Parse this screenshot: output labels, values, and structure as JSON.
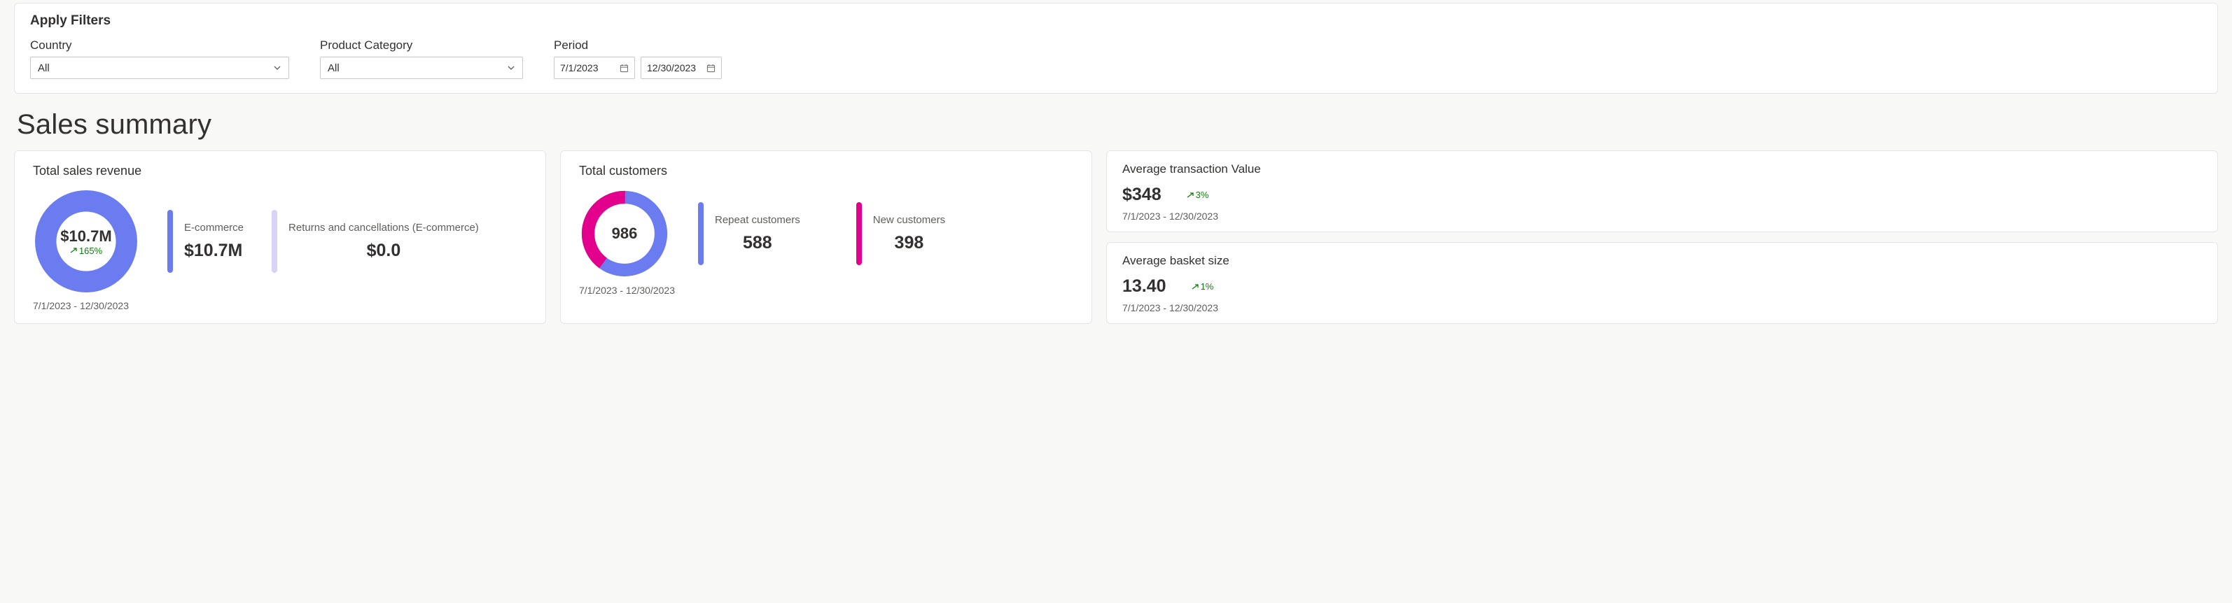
{
  "filters": {
    "title": "Apply Filters",
    "country": {
      "label": "Country",
      "value": "All"
    },
    "category": {
      "label": "Product Category",
      "value": "All"
    },
    "period": {
      "label": "Period",
      "start": "7/1/2023",
      "end": "12/30/2023"
    }
  },
  "section_title": "Sales summary",
  "revenue": {
    "title": "Total sales revenue",
    "daterange": "7/1/2023 - 12/30/2023",
    "total": "$10.7M",
    "delta": "165%",
    "ecommerce": {
      "label": "E-commerce",
      "value": "$10.7M"
    },
    "returns": {
      "label": "Returns and cancellations (E-commerce)",
      "value": "$0.0"
    }
  },
  "customers": {
    "title": "Total customers",
    "daterange": "7/1/2023 - 12/30/2023",
    "total": "986",
    "repeat": {
      "label": "Repeat customers",
      "value": "588"
    },
    "new": {
      "label": "New customers",
      "value": "398"
    }
  },
  "avg_txn": {
    "title": "Average transaction Value",
    "value": "$348",
    "delta": "3%",
    "daterange": "7/1/2023 - 12/30/2023"
  },
  "avg_basket": {
    "title": "Average basket size",
    "value": "13.40",
    "delta": "1%",
    "daterange": "7/1/2023 - 12/30/2023"
  },
  "colors": {
    "blue": "#6b7cf0",
    "lav": "#d8d3f5",
    "pink": "#e3008c",
    "green": "#107c10"
  },
  "chart_data": [
    {
      "type": "pie",
      "title": "Total sales revenue",
      "series": [
        {
          "name": "E-commerce",
          "value": 10.7,
          "unit": "$M",
          "color": "#6b7cf0"
        },
        {
          "name": "Returns and cancellations (E-commerce)",
          "value": 0.0,
          "unit": "$M",
          "color": "#d8d3f5"
        }
      ],
      "center_label": "$10.7M",
      "delta_pct": 165
    },
    {
      "type": "pie",
      "title": "Total customers",
      "series": [
        {
          "name": "Repeat customers",
          "value": 588,
          "color": "#6b7cf0"
        },
        {
          "name": "New customers",
          "value": 398,
          "color": "#e3008c"
        }
      ],
      "center_label": "986"
    }
  ]
}
